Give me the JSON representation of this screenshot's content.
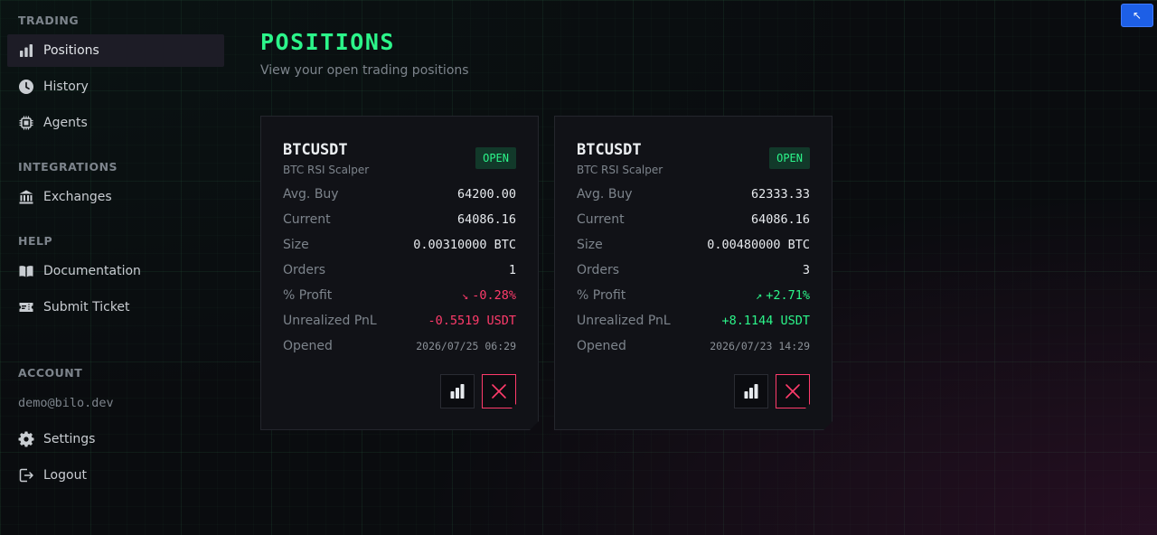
{
  "sidebar": {
    "sections": {
      "trading": "TRADING",
      "integrations": "INTEGRATIONS",
      "help": "HELP",
      "account": "ACCOUNT"
    },
    "items": {
      "positions": "Positions",
      "history": "History",
      "agents": "Agents",
      "exchanges": "Exchanges",
      "documentation": "Documentation",
      "submit_ticket": "Submit Ticket",
      "settings": "Settings",
      "logout": "Logout"
    },
    "active_item": "Positions",
    "account_email": "demo@bilo.dev"
  },
  "page": {
    "title": "POSITIONS",
    "subtitle": "View your open trading positions"
  },
  "labels": {
    "avg_buy": "Avg. Buy",
    "current": "Current",
    "size": "Size",
    "orders": "Orders",
    "profit": "% Profit",
    "unrealized_pnl": "Unrealized PnL",
    "opened": "Opened"
  },
  "positions": [
    {
      "symbol": "BTCUSDT",
      "strategy": "BTC RSI Scalper",
      "status": "OPEN",
      "avg_buy": "64200.00",
      "current": "64086.16",
      "size": "0.00310000 BTC",
      "orders": "1",
      "profit_trend": "↘",
      "profit": "-0.28%",
      "unrealized_pnl": "-0.5519 USDT",
      "opened": "2026/07/25 06:29"
    },
    {
      "symbol": "BTCUSDT",
      "strategy": "BTC RSI Scalper",
      "status": "OPEN",
      "avg_buy": "62333.33",
      "current": "64086.16",
      "size": "0.00480000 BTC",
      "orders": "3",
      "profit_trend": "↗",
      "profit": "+2.71%",
      "unrealized_pnl": "+8.1144 USDT",
      "opened": "2026/07/23 14:29"
    }
  ],
  "corner_button": {
    "glyph": "↖"
  },
  "colors": {
    "accent_green": "#2cf58a",
    "negative_red": "#ff3b6b",
    "corner_blue": "#1d5fe6"
  }
}
